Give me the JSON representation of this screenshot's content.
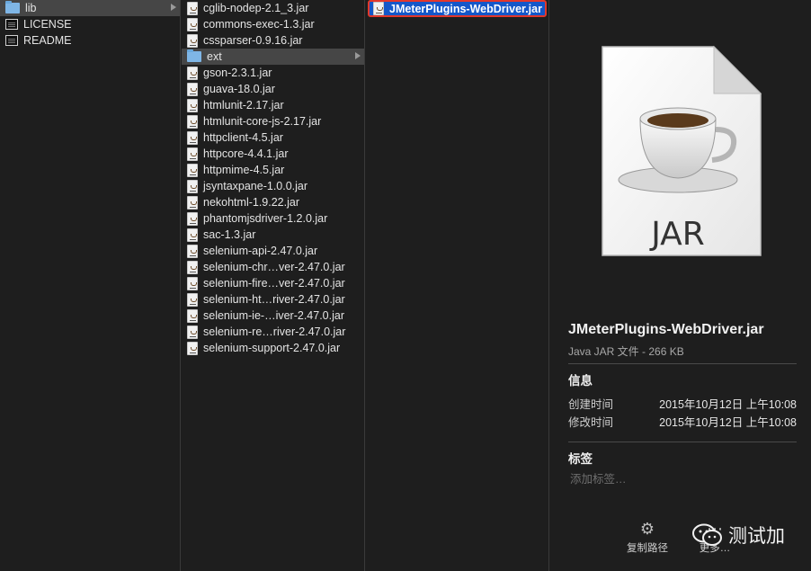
{
  "column1": {
    "items": [
      {
        "label": "lib",
        "type": "folder"
      },
      {
        "label": "LICENSE",
        "type": "doc"
      },
      {
        "label": "README",
        "type": "doc"
      }
    ]
  },
  "column2": {
    "items": [
      {
        "label": "cglib-nodep-2.1_3.jar",
        "type": "jar"
      },
      {
        "label": "commons-exec-1.3.jar",
        "type": "jar"
      },
      {
        "label": "cssparser-0.9.16.jar",
        "type": "jar"
      },
      {
        "label": "ext",
        "type": "folder"
      },
      {
        "label": "gson-2.3.1.jar",
        "type": "jar"
      },
      {
        "label": "guava-18.0.jar",
        "type": "jar"
      },
      {
        "label": "htmlunit-2.17.jar",
        "type": "jar"
      },
      {
        "label": "htmlunit-core-js-2.17.jar",
        "type": "jar"
      },
      {
        "label": "httpclient-4.5.jar",
        "type": "jar"
      },
      {
        "label": "httpcore-4.4.1.jar",
        "type": "jar"
      },
      {
        "label": "httpmime-4.5.jar",
        "type": "jar"
      },
      {
        "label": "jsyntaxpane-1.0.0.jar",
        "type": "jar"
      },
      {
        "label": "nekohtml-1.9.22.jar",
        "type": "jar"
      },
      {
        "label": "phantomjsdriver-1.2.0.jar",
        "type": "jar"
      },
      {
        "label": "sac-1.3.jar",
        "type": "jar"
      },
      {
        "label": "selenium-api-2.47.0.jar",
        "type": "jar"
      },
      {
        "label": "selenium-chr…ver-2.47.0.jar",
        "type": "jar"
      },
      {
        "label": "selenium-fire…ver-2.47.0.jar",
        "type": "jar"
      },
      {
        "label": "selenium-ht…river-2.47.0.jar",
        "type": "jar"
      },
      {
        "label": "selenium-ie-…iver-2.47.0.jar",
        "type": "jar"
      },
      {
        "label": "selenium-re…river-2.47.0.jar",
        "type": "jar"
      },
      {
        "label": "selenium-support-2.47.0.jar",
        "type": "jar"
      }
    ]
  },
  "column3": {
    "items": [
      {
        "label": "JMeterPlugins-WebDriver.jar",
        "type": "jar"
      }
    ]
  },
  "preview": {
    "icon_label": "JAR",
    "file_name": "JMeterPlugins-WebDriver.jar",
    "file_meta": "Java JAR 文件 - 266 KB",
    "info_title": "信息",
    "created_key": "创建时间",
    "created_value": "2015年10月12日 上午10:08",
    "modified_key": "修改时间",
    "modified_value": "2015年10月12日 上午10:08",
    "tags_title": "标签",
    "tags_placeholder": "添加标签…",
    "copy_path_label": "复制路径",
    "more_label": "更多…"
  },
  "watermark": {
    "text": "测试加"
  },
  "colors": {
    "selection_blue": "#1457c9",
    "highlight_red": "#e2382c",
    "folder_blue": "#7fb6e6"
  }
}
